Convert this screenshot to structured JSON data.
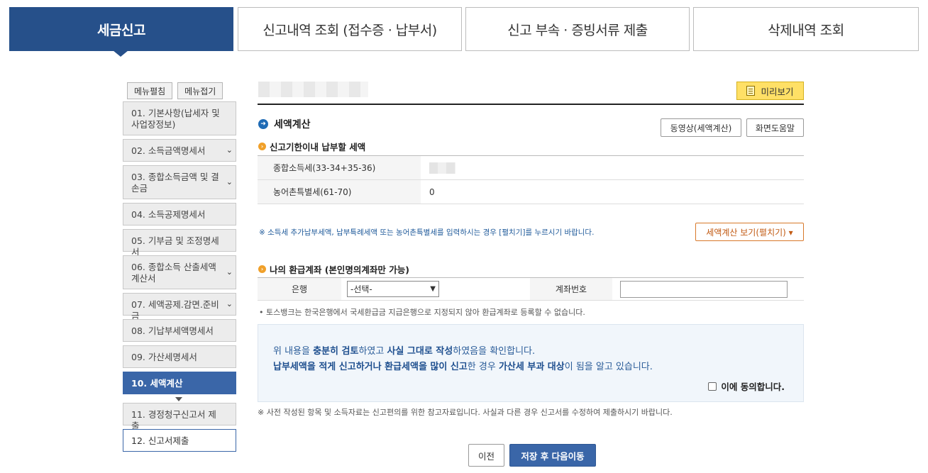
{
  "tabs": [
    {
      "label": "세금신고",
      "active": true
    },
    {
      "label": "신고내역 조회 (접수증 · 납부서)",
      "active": false
    },
    {
      "label": "신고 부속 · 증빙서류 제출",
      "active": false
    },
    {
      "label": "삭제내역 조회",
      "active": false
    }
  ],
  "menu_controls": {
    "expand": "메뉴펼침",
    "collapse": "메뉴접기"
  },
  "sidebar": {
    "items": [
      {
        "label": "01. 기본사항(납세자 및 사업장정보)"
      },
      {
        "label": "02. 소득금액명세서"
      },
      {
        "label": "03. 종합소득금액 및 결손금"
      },
      {
        "label": "04. 소득공제명세서"
      },
      {
        "label": "05. 기부금 및 조정명세서"
      },
      {
        "label": "06. 종합소득 산출세액계산서"
      },
      {
        "label": "07. 세액공제.감면.준비금"
      },
      {
        "label": "08. 기납부세액명세서"
      },
      {
        "label": "09. 가산세명세서"
      },
      {
        "label": "10. 세액계산"
      },
      {
        "label": "11. 경정청구신고서 제출"
      },
      {
        "label": "12. 신고서제출"
      }
    ]
  },
  "preview_button": "미리보기",
  "section": {
    "title": "세액계산",
    "video_button": "동영상(세액계산)",
    "help_button": "화면도움말"
  },
  "tax_due": {
    "title": "신고기한이내 납부할 세액",
    "rows": [
      {
        "label": "종합소득세(33-34+35-36)",
        "value": ""
      },
      {
        "label": "농어촌특별세(61-70)",
        "value": "0"
      }
    ]
  },
  "notice_additional": "※ 소득세 추가납부세액, 납부특례세액 또는 농어촌특별세를 입력하시는 경우 [펼치기]를 누르시기 바랍니다.",
  "expand_button": "세액계산 보기(펼치기) ▾",
  "refund": {
    "title": "나의 환급계좌 (본인명의계좌만 가능)",
    "bank_label": "은행",
    "bank_selected": "-선택-",
    "account_label": "계좌번호",
    "account_value": "",
    "note": "• 토스뱅크는 한국은행에서 국세환급금 지급은행으로 지정되지 않아 환급계좌로 등록할 수 없습니다."
  },
  "confirm": {
    "line1_a": "위 내용을 ",
    "line1_b": "충분히 검토",
    "line1_c": "하였고 ",
    "line1_d": "사실 그대로 작성",
    "line1_e": "하였음을 확인합니다.",
    "line2_a": "납부세액을 적게 신고하거나 환급세액을 많이 신고",
    "line2_b": "한 경우 ",
    "line2_c": "가산세 부과 대상",
    "line2_d": "이 됨을 알고 있습니다.",
    "agree_label": "이에 동의합니다."
  },
  "footer_note": "※ 사전 작성된 항목 및 소득자료는 신고편의를 위한 참고자료입니다. 사실과 다른 경우 신고서를 수정하여 제출하시기 바랍니다.",
  "buttons": {
    "prev": "이전",
    "next": "저장 후 다음이동"
  }
}
